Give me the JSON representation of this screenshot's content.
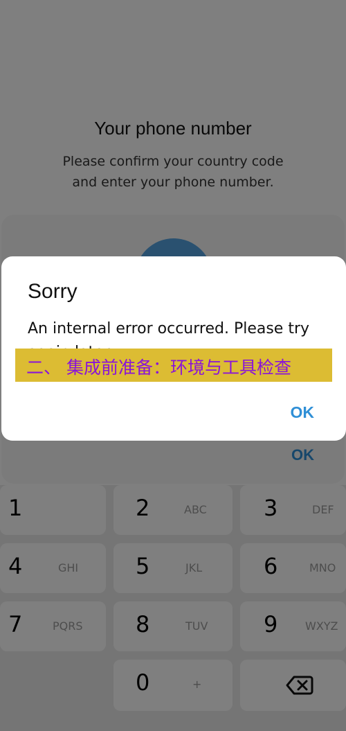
{
  "header": {
    "title": "Your phone number",
    "subtitle_line1": "Please confirm your country code",
    "subtitle_line2": "and enter your phone number."
  },
  "background_card": {
    "ok_label": "OK"
  },
  "keypad": {
    "keys": [
      {
        "digit": "1",
        "letters": ""
      },
      {
        "digit": "2",
        "letters": "ABC"
      },
      {
        "digit": "3",
        "letters": "DEF"
      },
      {
        "digit": "4",
        "letters": "GHI"
      },
      {
        "digit": "5",
        "letters": "JKL"
      },
      {
        "digit": "6",
        "letters": "MNO"
      },
      {
        "digit": "7",
        "letters": "PQRS"
      },
      {
        "digit": "8",
        "letters": "TUV"
      },
      {
        "digit": "9",
        "letters": "WXYZ"
      },
      {
        "digit": "0",
        "letters": "+"
      }
    ],
    "backspace_icon": "backspace-icon"
  },
  "dialog": {
    "title": "Sorry",
    "message": "An internal error occurred. Please try again later.",
    "ok_label": "OK"
  },
  "banner": {
    "text": "二、 集成前准备：环境与工具检查"
  },
  "colors": {
    "accent": "#2f8fd6",
    "avatar": "#54a3e0",
    "banner_bg": "#dcbc33",
    "banner_text": "#8a14d8"
  }
}
